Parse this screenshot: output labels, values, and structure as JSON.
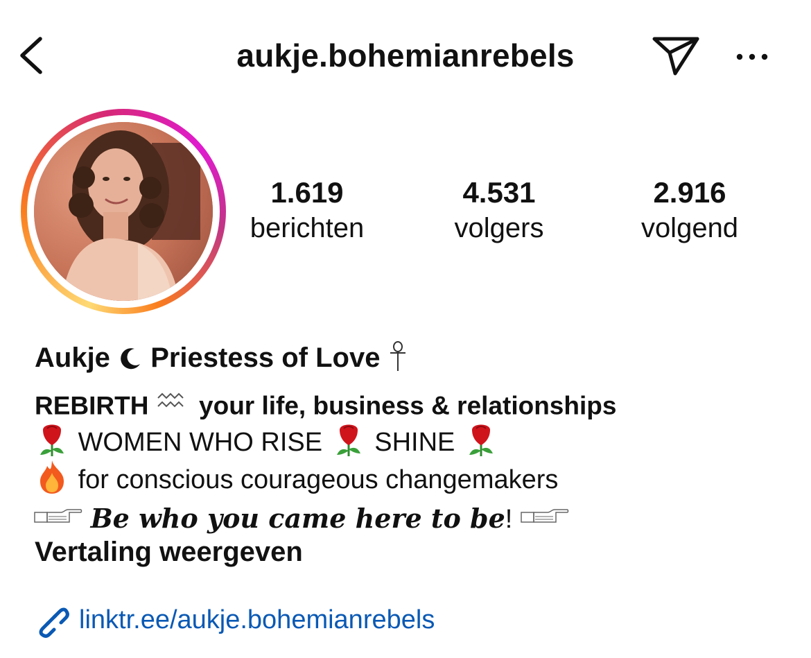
{
  "header": {
    "title": "aukje.bohemianrebels",
    "back_icon": "chevron-left-icon",
    "send_icon": "paper-plane-icon",
    "more_icon": "ellipsis-icon"
  },
  "profile": {
    "avatar": "profile-photo",
    "ring_colors": [
      "#feda75",
      "#fa7e1e",
      "#d62976",
      "#e01bd0",
      "#c13584"
    ]
  },
  "stats": [
    {
      "value": "1.619",
      "label": "berichten"
    },
    {
      "value": "4.531",
      "label": "volgers"
    },
    {
      "value": "2.916",
      "label": "volgend"
    }
  ],
  "bio": {
    "name_a": "Aukje",
    "name_b": "Priestess of Love",
    "line1_a": "REBIRTH",
    "line1_b": "your life, business & relationships",
    "line2_a": "WOMEN WHO RISE",
    "line2_b": "SHINE",
    "line3": "for conscious courageous changemakers",
    "line4_tag": "Be who you came here to be",
    "line4_end": "!"
  },
  "translate_label": "Vertaling weergeven",
  "link": {
    "icon": "link-icon",
    "text": "linktr.ee/aukje.bohemianrebels",
    "color": "#0a59b4"
  }
}
